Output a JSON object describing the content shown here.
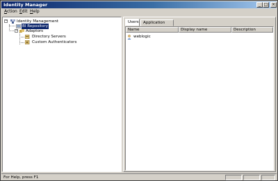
{
  "window": {
    "title": "Identity Manager"
  },
  "caption_buttons": {
    "minimize": "_",
    "maximize": "□",
    "close": "×"
  },
  "menu": [
    {
      "key": "A",
      "rest": "ction"
    },
    {
      "key": "E",
      "rest": "dit"
    },
    {
      "key": "H",
      "rest": "elp"
    }
  ],
  "tree": {
    "root": {
      "label": "Identity Management",
      "expander": "−"
    },
    "repository": {
      "label": "BI Repository"
    },
    "adaptors": {
      "label": "Adaptors",
      "expander": "−"
    },
    "directory_servers": {
      "label": "Directory Servers"
    },
    "custom_authenticators": {
      "label": "Custom Authenticators"
    }
  },
  "tabs": [
    "Users",
    "Application Roles"
  ],
  "list": {
    "columns": [
      "Name",
      "Display name",
      "Description"
    ],
    "rows": [
      {
        "name": "weblogic"
      }
    ]
  },
  "status": {
    "text": "For Help, press F1"
  }
}
